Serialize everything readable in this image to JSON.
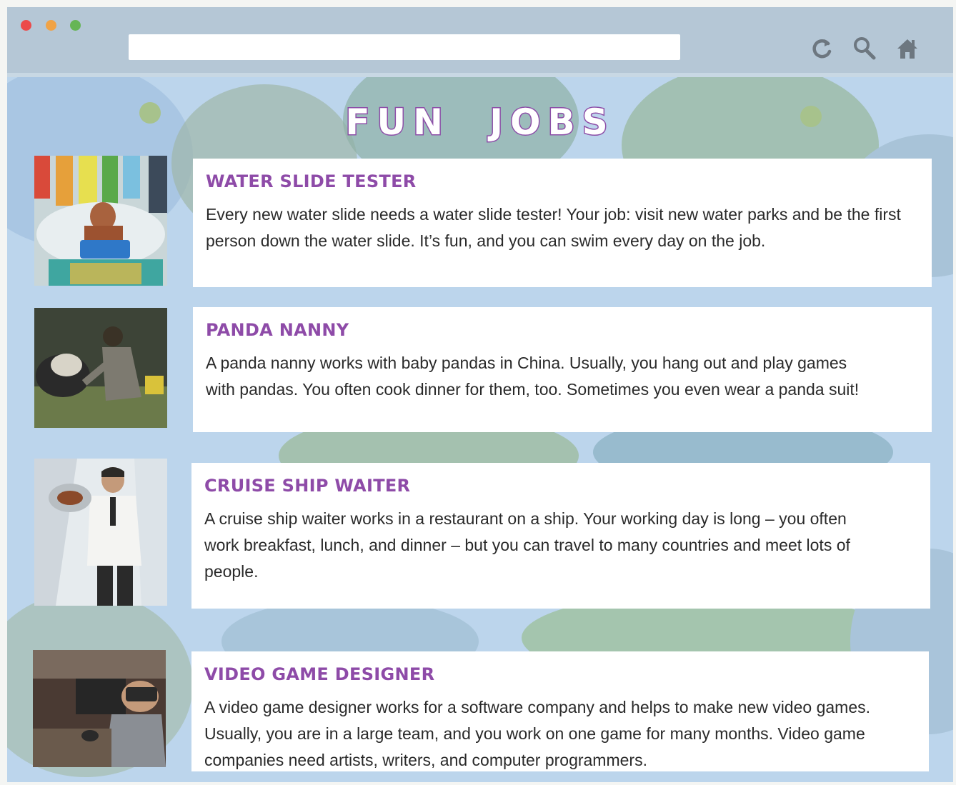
{
  "browser": {
    "url": "",
    "icons": [
      "reload-icon",
      "search-icon",
      "home-icon"
    ]
  },
  "page": {
    "heading": "FUN JOBS",
    "jobs": [
      {
        "title": "WATER SLIDE TESTER",
        "description": "Every new water slide needs a water slide tester! Your job: visit new water parks and be the first person down the water slide. It’s fun, and you can swim every day on the job.",
        "photo": "water-slide-photo"
      },
      {
        "title": "PANDA NANNY",
        "description": "A panda nanny works with baby pandas in China. Usually, you hang out and play games with pandas. You often cook dinner for them, too. Sometimes you even wear a panda suit!",
        "photo": "panda-nanny-photo"
      },
      {
        "title": "CRUISE SHIP WAITER",
        "description": "A cruise ship waiter works in a restaurant on a ship. Your working day is long – you often work breakfast, lunch, and dinner – but you can travel to many countries and meet lots of people.",
        "photo": "cruise-waiter-photo"
      },
      {
        "title": "VIDEO GAME DESIGNER",
        "description": "A video game designer works for a software company and helps to make new video games. Usually, you are in a large team, and you work on one game for many months. Video game companies need artists, writers, and computer programmers.",
        "photo": "game-designer-photo"
      }
    ]
  },
  "colors": {
    "accent": "#8e4ba8",
    "titlebar": "#b5c7d6",
    "background": "#bcd5ec"
  }
}
